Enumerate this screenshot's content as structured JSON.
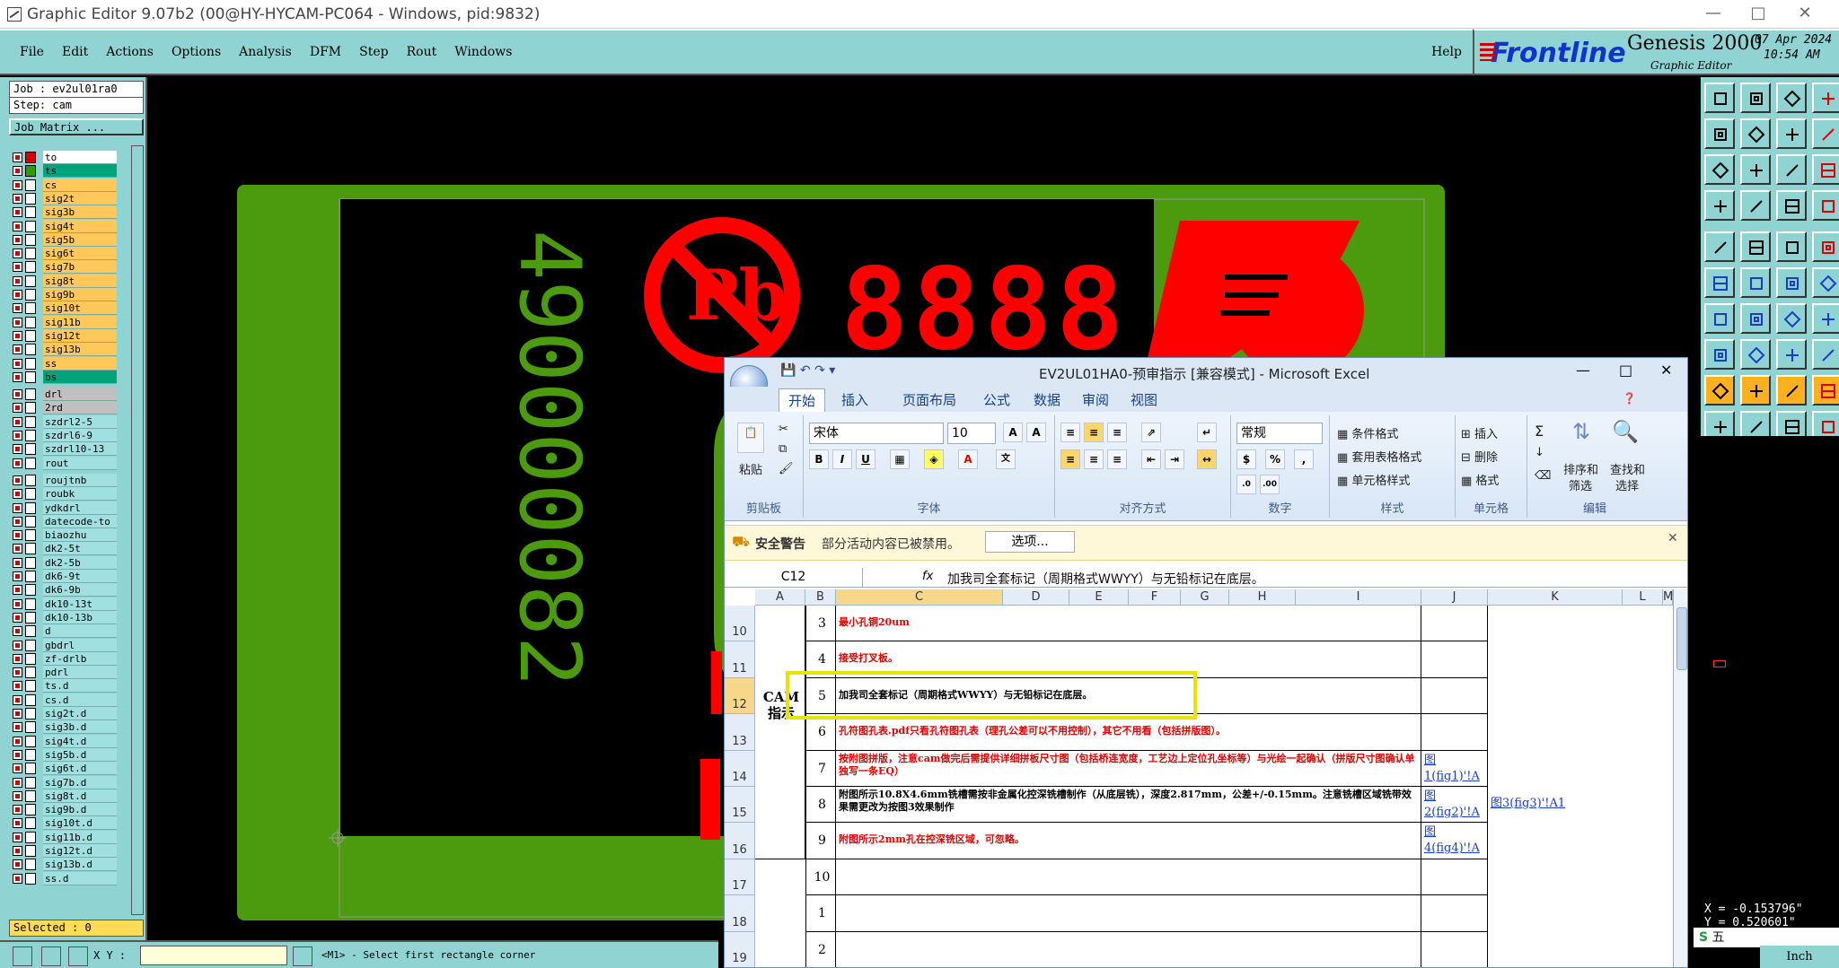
{
  "window": {
    "title": "Graphic Editor 9.07b2 (00@HY-HYCAM-PC064 - Windows, pid:9832)"
  },
  "menu": {
    "items": [
      "File",
      "Edit",
      "Actions",
      "Options",
      "Analysis",
      "DFM",
      "Step",
      "Rout",
      "Windows"
    ],
    "help": "Help"
  },
  "brand": {
    "logo": "Frontline",
    "product": "Genesis 2000",
    "subtitle": "Graphic Editor",
    "date": "07 Apr 2024",
    "time": "10:54 AM"
  },
  "job": {
    "job": "Job : ev2ul01ra0",
    "step": "Step: cam",
    "matrix": "Job Matrix ...",
    "selected": "Selected : 0"
  },
  "layers": [
    {
      "name": "to",
      "color": "#ffffff"
    },
    {
      "name": "ts",
      "color": "#00a37a"
    },
    {
      "name": "cs",
      "color": "#ffc85a"
    },
    {
      "name": "sig2t",
      "color": "#ffc85a"
    },
    {
      "name": "sig3b",
      "color": "#ffc85a"
    },
    {
      "name": "sig4t",
      "color": "#ffc85a"
    },
    {
      "name": "sig5b",
      "color": "#ffc85a"
    },
    {
      "name": "sig6t",
      "color": "#ffc85a"
    },
    {
      "name": "sig7b",
      "color": "#ffc85a"
    },
    {
      "name": "sig8t",
      "color": "#ffc85a"
    },
    {
      "name": "sig9b",
      "color": "#ffc85a"
    },
    {
      "name": "sig10t",
      "color": "#ffc85a"
    },
    {
      "name": "sig11b",
      "color": "#ffc85a"
    },
    {
      "name": "sig12t",
      "color": "#ffc85a"
    },
    {
      "name": "sig13b",
      "color": "#ffc85a"
    },
    {
      "name": "ss",
      "color": "#ffc85a"
    },
    {
      "name": "bs",
      "color": "#00a37a"
    },
    {
      "name": "drl",
      "color": "#c0c0c0"
    },
    {
      "name": "2rd",
      "color": "#c0c0c0"
    },
    {
      "name": "szdrl2-5",
      "color": "#a0e0e0"
    },
    {
      "name": "szdrl6-9",
      "color": "#a0e0e0"
    },
    {
      "name": "szdrl10-13",
      "color": "#a0e0e0"
    },
    {
      "name": "rout",
      "color": "#a0e0e0"
    },
    {
      "name": "roujtnb",
      "color": "#a0e0e0"
    },
    {
      "name": "roubk",
      "color": "#a0e0e0"
    },
    {
      "name": "ydkdrl",
      "color": "#a0e0e0"
    },
    {
      "name": "datecode-to",
      "color": "#a0e0e0"
    },
    {
      "name": "biaozhu",
      "color": "#a0e0e0"
    },
    {
      "name": "dk2-5t",
      "color": "#a0e0e0"
    },
    {
      "name": "dk2-5b",
      "color": "#a0e0e0"
    },
    {
      "name": "dk6-9t",
      "color": "#a0e0e0"
    },
    {
      "name": "dk6-9b",
      "color": "#a0e0e0"
    },
    {
      "name": "dk10-13t",
      "color": "#a0e0e0"
    },
    {
      "name": "dk10-13b",
      "color": "#a0e0e0"
    },
    {
      "name": "d",
      "color": "#a0e0e0"
    },
    {
      "name": "gbdrl",
      "color": "#a0e0e0"
    },
    {
      "name": "zf-drlb",
      "color": "#a0e0e0"
    },
    {
      "name": "pdrl",
      "color": "#a0e0e0"
    },
    {
      "name": "ts.d",
      "color": "#a0e0e0"
    },
    {
      "name": "cs.d",
      "color": "#a0e0e0"
    },
    {
      "name": "sig2t.d",
      "color": "#a0e0e0"
    },
    {
      "name": "sig3b.d",
      "color": "#a0e0e0"
    },
    {
      "name": "sig4t.d",
      "color": "#a0e0e0"
    },
    {
      "name": "sig5b.d",
      "color": "#a0e0e0"
    },
    {
      "name": "sig6t.d",
      "color": "#a0e0e0"
    },
    {
      "name": "sig7b.d",
      "color": "#a0e0e0"
    },
    {
      "name": "sig8t.d",
      "color": "#a0e0e0"
    },
    {
      "name": "sig9b.d",
      "color": "#a0e0e0"
    },
    {
      "name": "sig10t.d",
      "color": "#a0e0e0"
    },
    {
      "name": "sig11b.d",
      "color": "#a0e0e0"
    },
    {
      "name": "sig12t.d",
      "color": "#a0e0e0"
    },
    {
      "name": "sig13b.d",
      "color": "#a0e0e0"
    },
    {
      "name": "ss.d",
      "color": "#a0e0e0"
    }
  ],
  "status": {
    "xy_label": "X Y :",
    "message": "<M1> - Select first rectangle corner"
  },
  "board": {
    "part_number": "490000082",
    "date_code": "8888",
    "pb_text": "Pb"
  },
  "excel": {
    "title": "EV2UL01HA0-预审指示  [兼容模式] - Microsoft Excel",
    "tabs": [
      "开始",
      "插入",
      "页面布局",
      "公式",
      "数据",
      "审阅",
      "视图"
    ],
    "ribbon": {
      "paste": "粘贴",
      "clipboard": "剪贴板",
      "font_name": "宋体",
      "font_size": "10",
      "font": "字体",
      "alignment": "对齐方式",
      "number_format": "常规",
      "number": "数字",
      "cond_format": "条件格式",
      "table_format": "套用表格格式",
      "cell_style": "单元格样式",
      "styles": "样式",
      "insert": "插入",
      "delete": "删除",
      "format": "格式",
      "cells": "单元格",
      "sort": "排序和",
      "sort2": "筛选",
      "find": "查找和",
      "find2": "选择",
      "editing": "编辑"
    },
    "security": {
      "label": "安全警告",
      "text": "部分活动内容已被禁用。",
      "button": "选项..."
    },
    "formula": {
      "cell": "C12",
      "fx": "fx",
      "value": "加我司全套标记（周期格式WWYY）与无铅标记在底层。"
    },
    "columns": [
      "A",
      "B",
      "C",
      "D",
      "E",
      "F",
      "G",
      "H",
      "I",
      "J",
      "K",
      "L",
      "M"
    ],
    "section": "CAM指示",
    "rows": [
      {
        "row": "10",
        "num": "3",
        "text": "最小孔铜20um",
        "style": "red",
        "j": "",
        "k": ""
      },
      {
        "row": "11",
        "num": "4",
        "text": "接受打叉板。",
        "style": "red",
        "j": "",
        "k": ""
      },
      {
        "row": "12",
        "num": "5",
        "text": "加我司全套标记（周期格式WWYY）与无铅标记在底层。",
        "style": "blk",
        "j": "",
        "k": ""
      },
      {
        "row": "13",
        "num": "6",
        "text": "孔符图孔表.pdf只看孔符图孔表（理孔公差可以不用控制），其它不用看（包括拼版图）。",
        "style": "red",
        "j": "",
        "k": ""
      },
      {
        "row": "14",
        "num": "7",
        "text": "按附图拼版，注意cam做完后需提供详细拼板尺寸图（包括桥连宽度，工艺边上定位孔坐标等）与光绘一起确认（拼版尺寸图确认单独写一条EQ）",
        "style": "red",
        "j": "图1(fig1)'!A",
        "k": ""
      },
      {
        "row": "15",
        "num": "8",
        "text": "附图所示10.8X4.6mm铣槽需按非金属化控深铣槽制作（从底层铣），深度2.817mm，公差+/-0.15mm。注意铣槽区域铣带效果需更改为按图3效果制作",
        "style": "blk",
        "j": "图2(fig2)'!A",
        "k": "图3(fig3)'!A1"
      },
      {
        "row": "16",
        "num": "9",
        "text": "附图所示2mm孔在控深铣区域，可忽略。",
        "style": "red",
        "j": "图4(fig4)'!A",
        "k": ""
      },
      {
        "row": "17",
        "num": "10",
        "text": "",
        "style": "blk",
        "j": "",
        "k": ""
      },
      {
        "row": "18",
        "num": "1",
        "text": "",
        "style": "blk",
        "j": "",
        "k": ""
      },
      {
        "row": "19",
        "num": "2",
        "text": "",
        "style": "blk",
        "j": "",
        "k": ""
      }
    ]
  },
  "coords": {
    "x": "X = -0.153796\"",
    "y": "Y = 0.520601\""
  },
  "units": "Inch",
  "ime": "五",
  "colors": {
    "panel": "#8fd3d3",
    "board_green": "#4c9a0e",
    "copper_red": "#ff0000",
    "excel_accent": "#15428b"
  }
}
